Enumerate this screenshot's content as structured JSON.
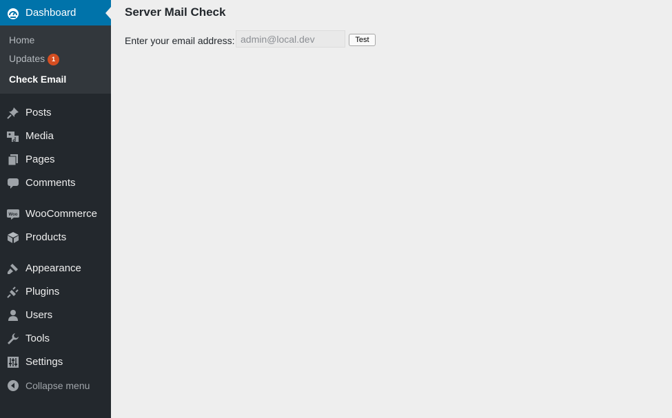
{
  "sidebar": {
    "dashboard": {
      "label": "Dashboard",
      "icon": "dashboard-icon"
    },
    "submenu": [
      {
        "label": "Home"
      },
      {
        "label": "Updates",
        "badge": "1"
      },
      {
        "label": "Check Email",
        "current": true
      }
    ],
    "menu": [
      {
        "label": "Posts",
        "icon": "pushpin-icon"
      },
      {
        "label": "Media",
        "icon": "media-icon"
      },
      {
        "label": "Pages",
        "icon": "pages-icon"
      },
      {
        "label": "Comments",
        "icon": "comment-icon"
      },
      {
        "label": "WooCommerce",
        "icon": "woocommerce-icon"
      },
      {
        "label": "Products",
        "icon": "products-box-icon"
      },
      {
        "label": "Appearance",
        "icon": "paintbrush-icon"
      },
      {
        "label": "Plugins",
        "icon": "plugin-icon"
      },
      {
        "label": "Users",
        "icon": "user-icon"
      },
      {
        "label": "Tools",
        "icon": "wrench-icon"
      },
      {
        "label": "Settings",
        "icon": "settings-sliders-icon"
      }
    ],
    "collapse_label": "Collapse menu"
  },
  "main": {
    "title": "Server Mail Check",
    "email_label": "Enter your email address:",
    "email_value": "admin@local.dev",
    "test_button": "Test"
  },
  "colors": {
    "sidebar_bg": "#23282d",
    "submenu_bg": "#32373c",
    "active_bg": "#0073aa",
    "badge": "#d54e21",
    "page_bg": "#eeeeee"
  }
}
